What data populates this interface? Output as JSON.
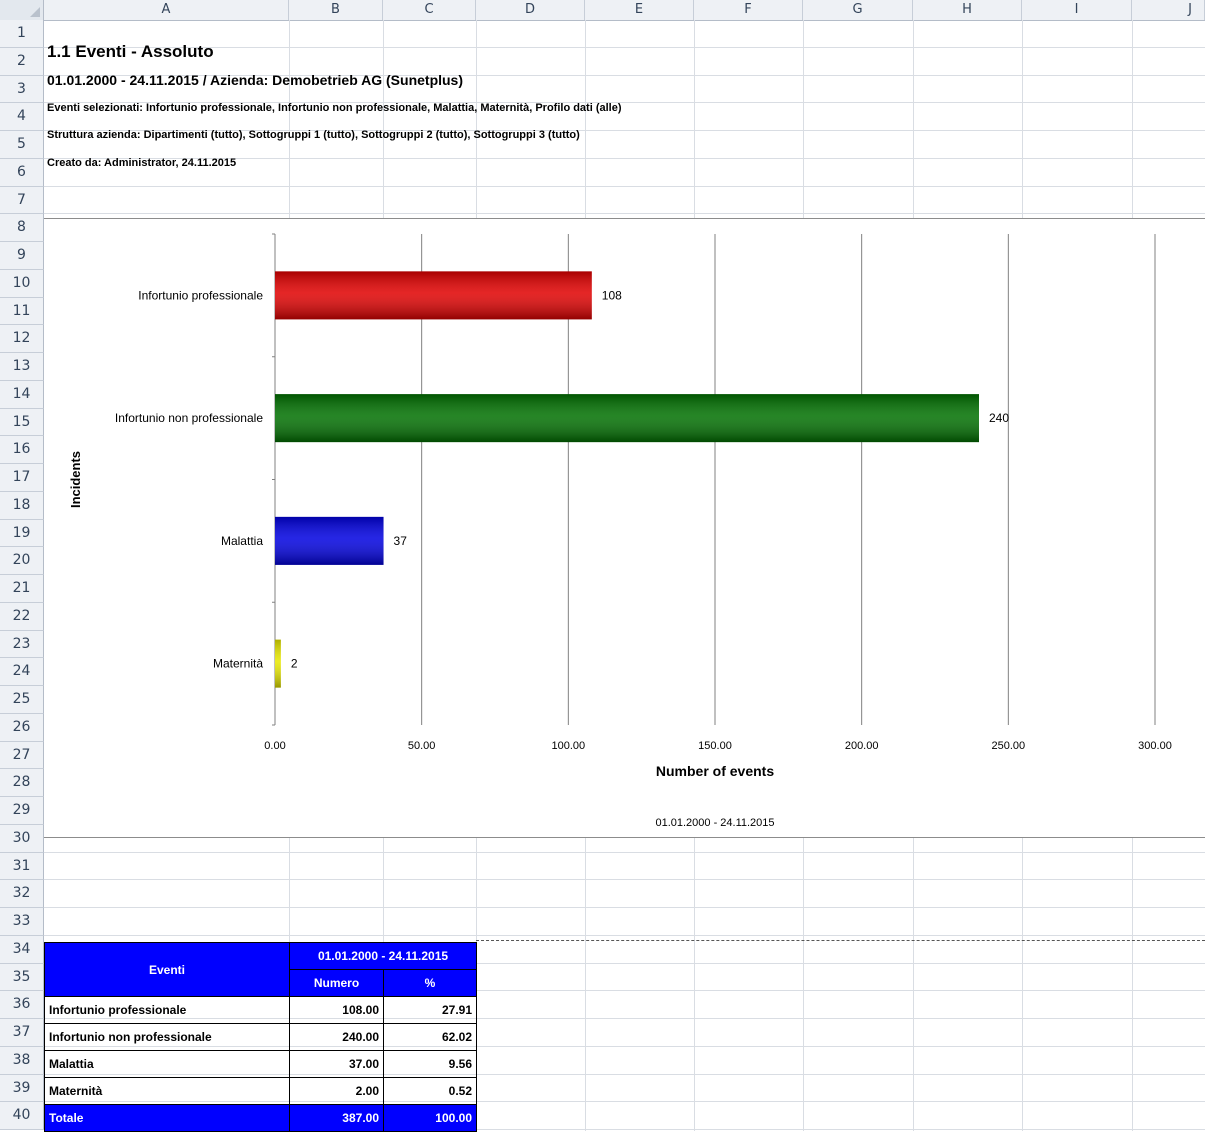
{
  "columns": [
    "A",
    "B",
    "C",
    "D",
    "E",
    "F",
    "G",
    "H",
    "I",
    "J"
  ],
  "rows": [
    "1",
    "2",
    "3",
    "4",
    "5",
    "6",
    "7",
    "8",
    "9",
    "10",
    "11",
    "12",
    "13",
    "14",
    "15",
    "16",
    "17",
    "18",
    "19",
    "20",
    "21",
    "22",
    "23",
    "24",
    "25",
    "26",
    "27",
    "28",
    "29",
    "30",
    "31",
    "32",
    "33",
    "34",
    "35",
    "36",
    "37",
    "38",
    "39",
    "40"
  ],
  "header": {
    "title": "1.1 Eventi - Assoluto",
    "subtitle": "01.01.2000 - 24.11.2015 / Azienda: Demobetrieb AG (Sunetplus)",
    "events": "Eventi selezionati: Infortunio professionale, Infortunio non professionale, Malattia, Maternità, Profilo dati (alle)",
    "structure": "Struttura azienda: Dipartimenti (tutto), Sottogruppi 1 (tutto), Sottogruppi 2 (tutto), Sottogruppi 3 (tutto)",
    "created": "Creato da: Administrator, 24.11.2015"
  },
  "chart_data": {
    "type": "bar",
    "orientation": "horizontal",
    "categories": [
      "Infortunio professionale",
      "Infortunio non professionale",
      "Malattia",
      "Maternità"
    ],
    "values": [
      108,
      240,
      37,
      2
    ],
    "value_labels": [
      "108",
      "240",
      "37",
      "2"
    ],
    "colors": [
      "#e00000",
      "#007000",
      "#0000e0",
      "#e8e800"
    ],
    "xlabel": "Number of events",
    "ylabel": "Incidents",
    "xlim": [
      0,
      300
    ],
    "ticks": [
      0,
      50,
      100,
      150,
      200,
      250,
      300
    ],
    "tick_labels": [
      "0.00",
      "50.00",
      "100.00",
      "150.00",
      "200.00",
      "250.00",
      "300.00"
    ],
    "period": "01.01.2000 - 24.11.2015",
    "grid": true
  },
  "table": {
    "col_header": "Eventi",
    "period": "01.01.2000 - 24.11.2015",
    "num_header": "Numero",
    "pct_header": "%",
    "rows": [
      {
        "label": "Infortunio professionale",
        "num": "108.00",
        "pct": "27.91"
      },
      {
        "label": "Infortunio non professionale",
        "num": "240.00",
        "pct": "62.02"
      },
      {
        "label": "Malattia",
        "num": "37.00",
        "pct": "9.56"
      },
      {
        "label": "Maternità",
        "num": "2.00",
        "pct": "0.52"
      }
    ],
    "total": {
      "label": "Totale",
      "num": "387.00",
      "pct": "100.00"
    }
  }
}
